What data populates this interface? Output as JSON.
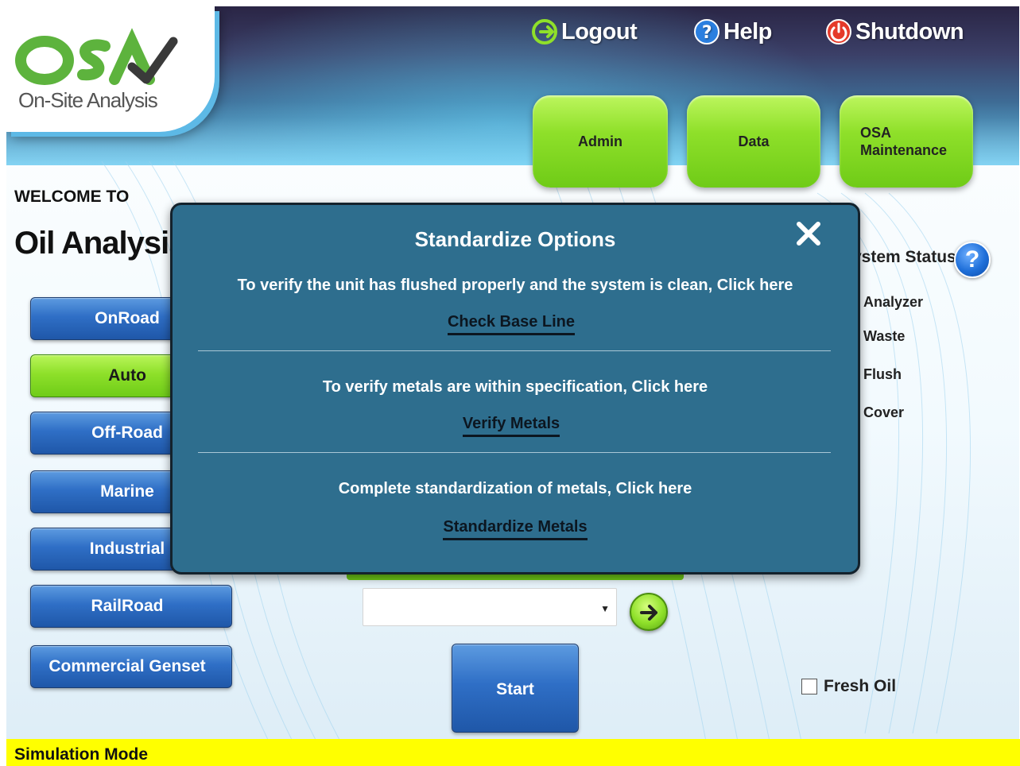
{
  "app": {
    "brand": "OSA",
    "tagline": "On-Site Analysis"
  },
  "header": {
    "top_links": [
      {
        "label": "Logout",
        "icon": "logout-icon"
      },
      {
        "label": "Help",
        "icon": "help-icon"
      },
      {
        "label": "Shutdown",
        "icon": "power-icon"
      }
    ],
    "nav": [
      {
        "label": "Admin"
      },
      {
        "label": "Data"
      },
      {
        "label": "OSA\nMaintenance"
      }
    ]
  },
  "main": {
    "welcome": "WELCOME TO",
    "title": "Oil Analysis",
    "categories": [
      {
        "label": "OnRoad"
      },
      {
        "label": "Auto",
        "active": true
      },
      {
        "label": "Off-Road"
      },
      {
        "label": "Marine"
      },
      {
        "label": "Industrial"
      },
      {
        "label": "RailRoad"
      },
      {
        "label": "Commercial Genset"
      }
    ],
    "select_value": "",
    "start_label": "Start",
    "fresh_oil_label": "Fresh Oil"
  },
  "system_status": {
    "title": "System Status",
    "items": [
      "Analyzer",
      "Waste",
      "Flush",
      "Cover"
    ]
  },
  "modal": {
    "title": "Standardize Options",
    "close_icon": "close-icon",
    "sections": [
      {
        "text": "To verify the unit has flushed properly and the system is clean, Click here",
        "link": "Check Base Line"
      },
      {
        "text": "To verify metals are within specification, Click here",
        "link": "Verify Metals"
      },
      {
        "text": "Complete standardization of metals, Click here",
        "link": "Standardize Metals"
      }
    ]
  },
  "footer": {
    "mode": "Simulation Mode"
  },
  "colors": {
    "accent_green": "#8fe02a",
    "button_blue": "#2f6fc6",
    "modal_bg": "#2e6e8e",
    "sim_bar": "#ffff00"
  }
}
